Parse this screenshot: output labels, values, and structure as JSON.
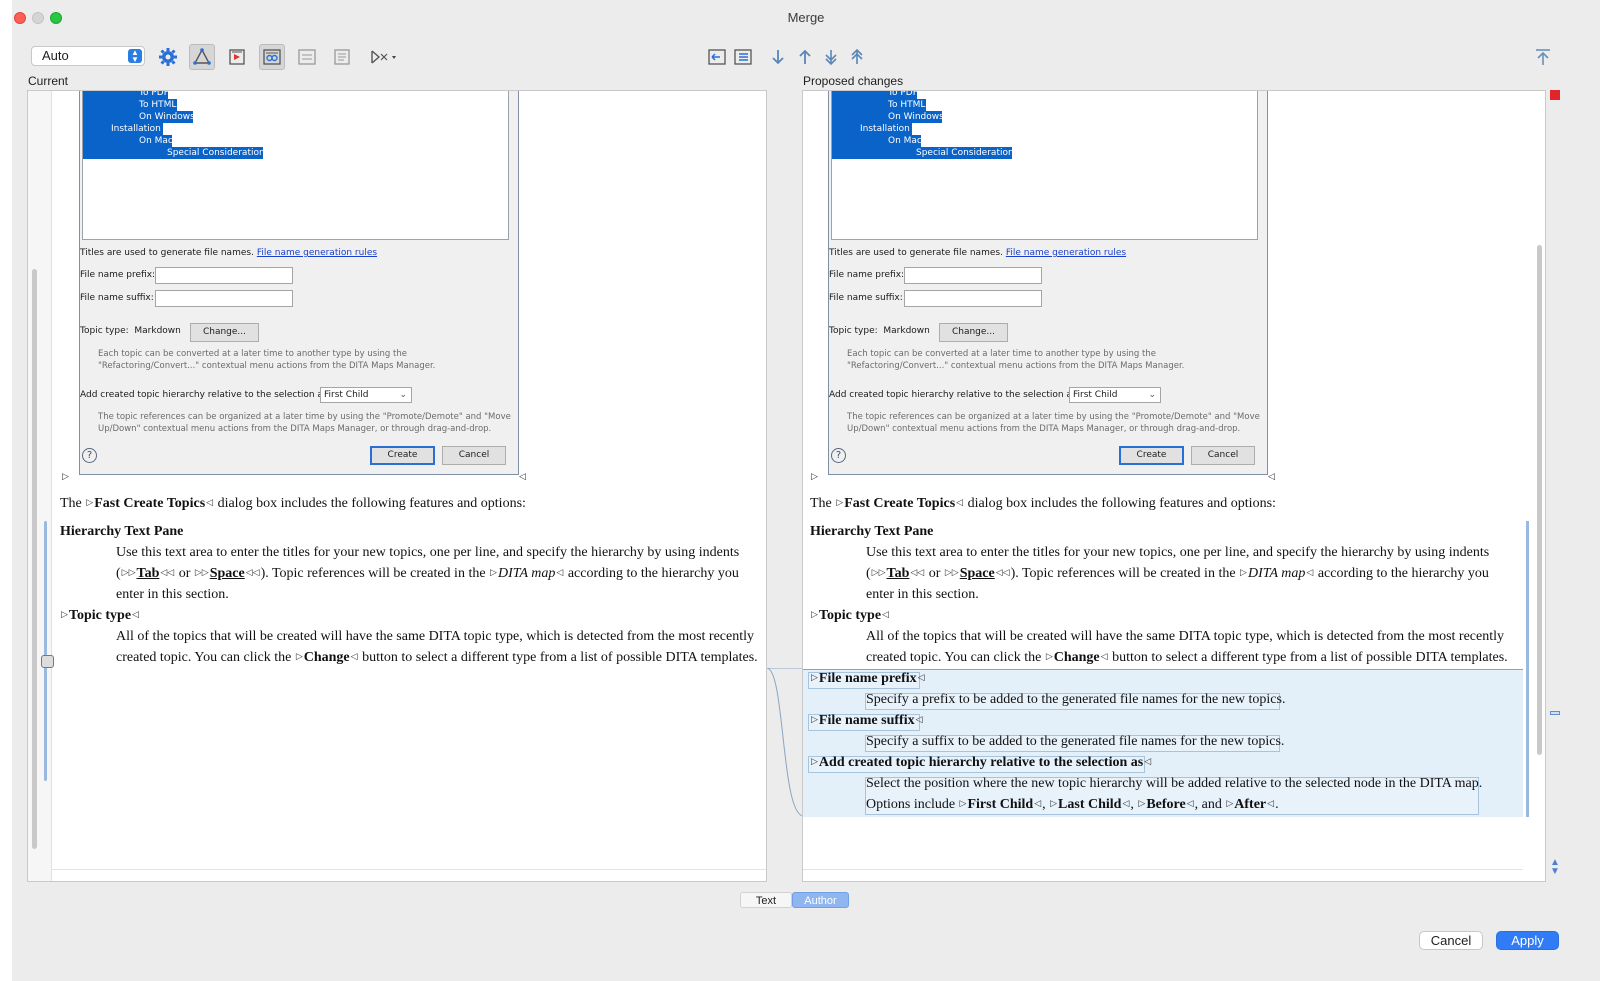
{
  "window": {
    "title": "Merge"
  },
  "toolbar": {
    "mode_select": "Auto",
    "icons": [
      "gear-icon",
      "outline-icon",
      "rewind-icon",
      "compare-words-icon",
      "compare-lines-icon",
      "format-icon",
      "merge-flag-icon",
      "prev-diff-left-icon",
      "list-icon",
      "down-arrow-icon",
      "up-arrow-icon",
      "last-diff-icon",
      "first-diff-icon",
      "top-icon"
    ]
  },
  "panes": {
    "left_label": "Current",
    "right_label": "Proposed changes"
  },
  "dialog_shot": {
    "tree": [
      "To PDF",
      "To HTML",
      "On Windows",
      "Installation",
      "On Mac",
      "Special Considerations"
    ],
    "titles_note": "Titles are used to generate file names.",
    "titles_link": "File name generation rules",
    "prefix_label": "File name prefix:",
    "suffix_label": "File name suffix:",
    "topic_type_label": "Topic type:",
    "topic_type_value": "Markdown",
    "change_button": "Change...",
    "convert_note_1": "Each topic can be converted at a later time to another type by using the",
    "convert_note_2": "\"Refactoring/Convert...\" contextual menu actions from the DITA Maps Manager.",
    "hierarchy_label": "Add created topic hierarchy relative to the selection as:",
    "hierarchy_value": "First Child",
    "organize_note_1": "The topic references can be organized at a later time by using the \"Promote/Demote\" and \"Move",
    "organize_note_2": "Up/Down\" contextual menu actions from the DITA Maps Manager, or through drag-and-drop.",
    "help": "?",
    "create_button": "Create",
    "cancel_button": "Cancel"
  },
  "doc": {
    "intro_pre": "The",
    "intro_bold": "Fast Create Topics",
    "intro_post": "dialog box includes the following features and options:",
    "h_pane": "Hierarchy Text Pane",
    "p_pane_1": "Use this text area to enter the titles for your new topics, one per line, and specify the hierarchy by using indents",
    "p_pane_2_a": "(",
    "p_pane_2_tab": "Tab",
    "p_pane_2_or": "or",
    "p_pane_2_space": "Space",
    "p_pane_2_b": "). Topic references will be created in the",
    "p_pane_2_map": "DITA map",
    "p_pane_2_c": "according to the hierarchy you",
    "p_pane_3": "enter in this section.",
    "h_type": "Topic type",
    "p_type_1": "All of the topics that will be created will have the same DITA topic type, which is detected from the most recently",
    "p_type_2_a": "created topic. You can click the",
    "p_type_2_bold": "Change",
    "p_type_2_b": "button to select a different type from a list of possible DITA templates.",
    "h_prefix": "File name prefix",
    "p_prefix": "Specify a prefix to be added to the generated file names for the new topics.",
    "h_suffix": "File name suffix",
    "p_suffix": "Specify a suffix to be added to the generated file names for the new topics.",
    "h_hier": "Add created topic hierarchy relative to the selection as",
    "p_hier_1": "Select the position where the new topic hierarchy will be added relative to the selected node in the DITA map.",
    "p_hier_2_a": "Options include",
    "p_hier_first": "First Child",
    "p_hier_last": "Last Child",
    "p_hier_before": "Before",
    "p_hier_and": ", and",
    "p_hier_after": "After",
    "comma": ",",
    "period": "."
  },
  "bottom_tabs": {
    "text": "Text",
    "author": "Author"
  },
  "buttons": {
    "cancel": "Cancel",
    "apply": "Apply"
  }
}
